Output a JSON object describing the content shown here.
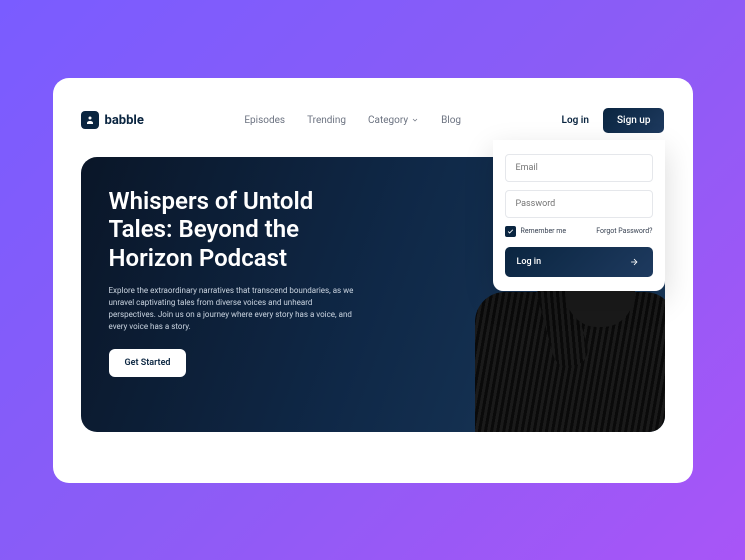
{
  "brand": {
    "name": "babble"
  },
  "nav": {
    "links": [
      "Episodes",
      "Trending",
      "Category",
      "Blog"
    ],
    "login": "Log in",
    "signup": "Sign up"
  },
  "hero": {
    "title": "Whispers of Untold Tales: Beyond the Horizon Podcast",
    "description": "Explore the extraordinary narratives that transcend boundaries, as we unravel captivating tales from diverse voices and unheard perspectives. Join us on a journey where every story has a voice, and every voice has a story.",
    "cta": "Get Started"
  },
  "login_form": {
    "email_placeholder": "Email",
    "password_placeholder": "Password",
    "remember": "Remember me",
    "forgot": "Forgot Password?",
    "submit": "Log in"
  }
}
